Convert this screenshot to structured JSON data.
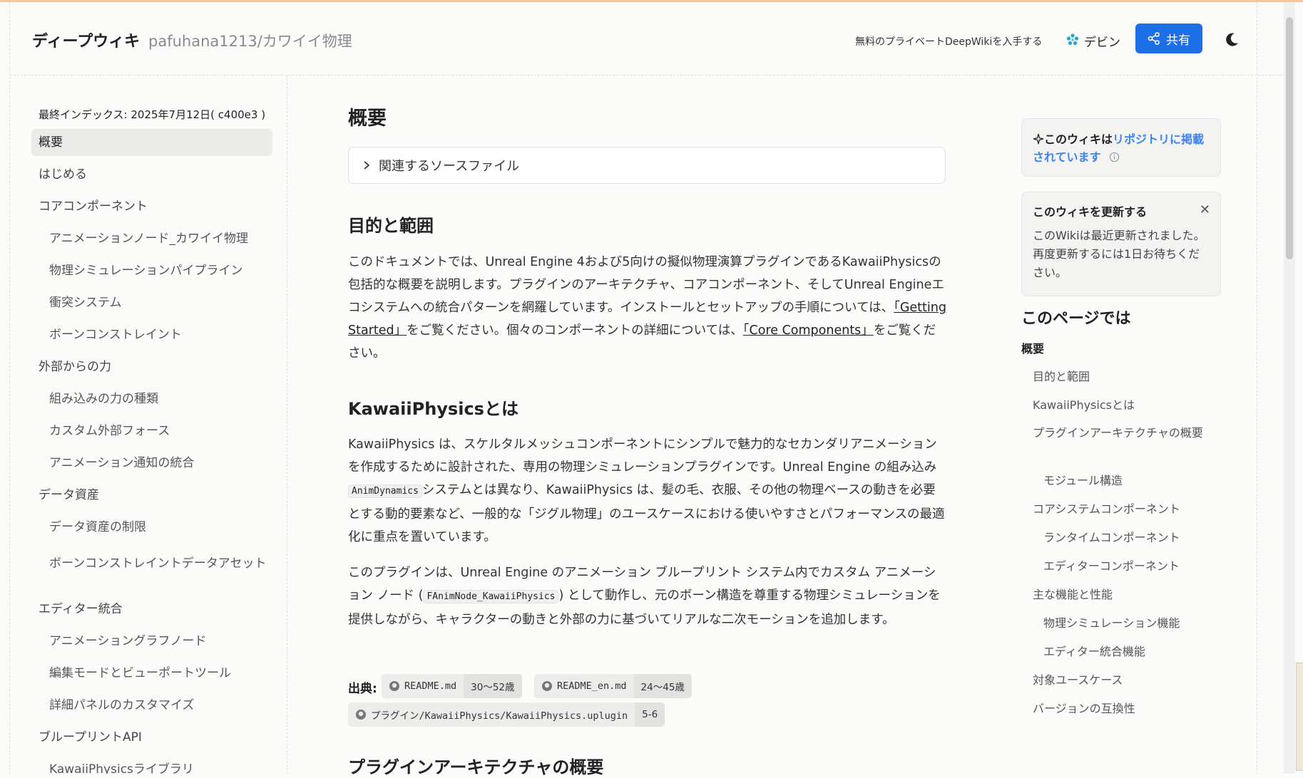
{
  "header": {
    "brand": "ディープウィキ",
    "repo": "pafuhana1213/カワイイ物理",
    "promo": "無料のプライベートDeepWikiを入手する",
    "devin": "デビン",
    "share": "共有"
  },
  "sidebar": {
    "last_indexed": "最終インデックス: 2025年7月12日( c400e3 )",
    "items": [
      {
        "label": "概要"
      },
      {
        "label": "はじめる"
      },
      {
        "label": "コアコンポーネント"
      },
      {
        "label": "アニメーションノード_カワイイ物理"
      },
      {
        "label": "物理シミュレーションパイプライン"
      },
      {
        "label": "衝突システム"
      },
      {
        "label": "ボーンコンストレイント"
      },
      {
        "label": "外部からの力"
      },
      {
        "label": "組み込みの力の種類"
      },
      {
        "label": "カスタム外部フォース"
      },
      {
        "label": "アニメーション通知の統合"
      },
      {
        "label": "データ資産"
      },
      {
        "label": "データ資産の制限"
      },
      {
        "label": "ボーンコンストレイントデータアセット"
      },
      {
        "label": "エディター統合"
      },
      {
        "label": "アニメーショングラフノード"
      },
      {
        "label": "編集モードとビューポートツール"
      },
      {
        "label": "詳細パネルのカスタマイズ"
      },
      {
        "label": "ブループリントAPI"
      },
      {
        "label": "KawaiiPhysicsライブラリ"
      }
    ]
  },
  "main": {
    "title": "概要",
    "source_files": "関連するソースファイル",
    "h_purpose": "目的と範囲",
    "p1_a": "このドキュメントでは、Unreal Engine 4および5向けの擬似物理演算プラグインであるKawaiiPhysicsの包括的な概要を説明します。プラグインのアーキテクチャ、コアコンポーネント、そしてUnreal Engineエコシステムへの統合パターンを網羅しています。インストールとセットアップの手順については、",
    "p1_link1": "「Getting Started」",
    "p1_b": "をご覧ください。個々のコンポーネントの詳細については、",
    "p1_link2": "「Core Components」",
    "p1_c": "をご覧ください。",
    "h_what": "KawaiiPhysicsとは",
    "p2_a": "KawaiiPhysics は、スケルタルメッシュコンポーネントにシンプルで魅力的なセカンダリアニメーションを作成するために設計された、専用の物理シミュレーションプラグインです。Unreal Engine の組み込み",
    "p2_code": "AnimDynamics",
    "p2_b": "システムとは異なり、KawaiiPhysics は、髪の毛、衣服、その他の物理ベースの動きを必要とする動的要素など、一般的な「ジグル物理」のユースケースにおける使いやすさとパフォーマンスの最適化に重点を置いています。",
    "p3_a": "このプラグインは、Unreal Engine のアニメーション ブループリント システム内でカスタム アニメーション ノード (",
    "p3_code": "FAnimNode_KawaiiPhysics",
    "p3_b": ") として動作し、元のボーン構造を尊重する物理シミュレーションを提供しながら、キャラクターの動きと外部の力に基づいてリアルな二次モーションを追加します。",
    "sources_label": "出典:",
    "sources": [
      {
        "file": "README.md",
        "lines": "30〜52歳"
      },
      {
        "file": "README_en.md",
        "lines": "24〜45歳"
      },
      {
        "file": "プラグイン/KawaiiPhysics/KawaiiPhysics.uplugin",
        "lines": "5-6"
      }
    ],
    "h_arch": "プラグインアーキテクチャの概要"
  },
  "right": {
    "card1_a": "このウィキは",
    "card1_link": "リポジトリに掲載されています",
    "card2_title": "このウィキを更新する",
    "card2_text": "このWikiは最近更新されました。再度更新するには1日お待ちください。",
    "toc_title": "このページでは",
    "toc": [
      "概要",
      "目的と範囲",
      "KawaiiPhysicsとは",
      "プラグインアーキテクチャの概要",
      "モジュール構造",
      "コアシステムコンポーネント",
      "ランタイムコンポーネント",
      "エディターコンポーネント",
      "主な機能と性能",
      "物理シミュレーション機能",
      "エディター統合機能",
      "対象ユースケース",
      "バージョンの互換性"
    ]
  },
  "colors": {
    "accent": "#1d6fe8",
    "link": "#3b82f6"
  }
}
